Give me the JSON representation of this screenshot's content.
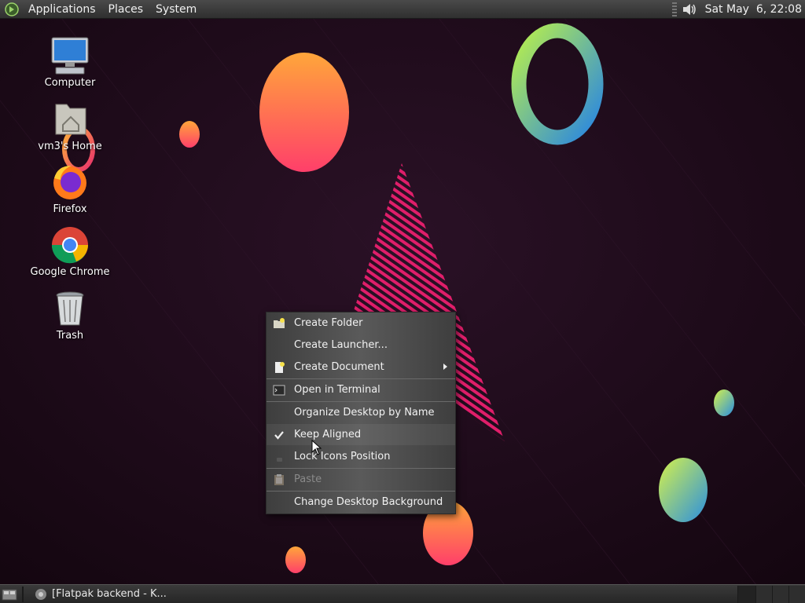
{
  "top_panel": {
    "menus": [
      "Applications",
      "Places",
      "System"
    ],
    "clock": "Sat May  6, 22:08"
  },
  "desktop_icons": [
    {
      "label": "Computer"
    },
    {
      "label": "vm3's Home"
    },
    {
      "label": "Firefox"
    },
    {
      "label": "Google Chrome"
    },
    {
      "label": "Trash"
    }
  ],
  "context_menu": {
    "items": [
      {
        "label": "Create Folder"
      },
      {
        "label": "Create Launcher..."
      },
      {
        "label": "Create Document"
      },
      {
        "label": "Open in Terminal"
      },
      {
        "label": "Organize Desktop by Name"
      },
      {
        "label": "Keep Aligned"
      },
      {
        "label": "Lock Icons Position"
      },
      {
        "label": "Paste"
      },
      {
        "label": "Change Desktop Background"
      }
    ]
  },
  "taskbar": {
    "task_label": "[Flatpak backend - K..."
  },
  "colors": {
    "panel": "#2f2f2f",
    "wallpaper": "#1c0b18",
    "accent_pink": "#e01e6a"
  }
}
